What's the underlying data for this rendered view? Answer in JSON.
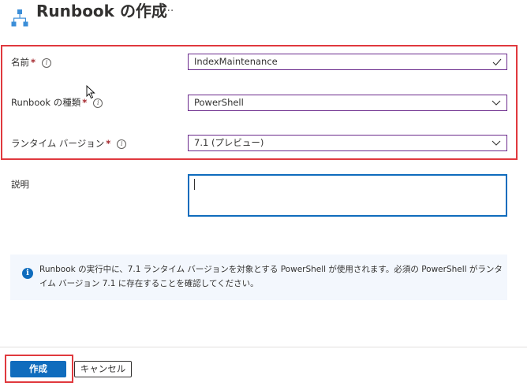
{
  "header": {
    "title": "Runbook の作成",
    "more": "···",
    "icon": "runbook-hierarchy-icon"
  },
  "form": {
    "name": {
      "label": "名前",
      "required_mark": "*",
      "value": "IndexMaintenance"
    },
    "runbook_type": {
      "label": "Runbook の種類",
      "required_mark": "*",
      "value": "PowerShell"
    },
    "runtime_version": {
      "label": "ランタイム バージョン",
      "required_mark": "*",
      "value": "7.1 (プレビュー)"
    },
    "description": {
      "label": "説明",
      "value": ""
    }
  },
  "info_message": "Runbook の実行中に、7.1 ランタイム バージョンを対象とする PowerShell が使用されます。必須の PowerShell がランタイム バージョン 7.1 に存在することを確認してください。",
  "footer": {
    "create_label": "作成",
    "cancel_label": "キャンセル"
  },
  "colors": {
    "accent": "#0f6cbd",
    "field_border": "#6b2a8c",
    "highlight": "#e0393e",
    "required": "#a4262c",
    "info_bg": "#f3f7fd"
  }
}
